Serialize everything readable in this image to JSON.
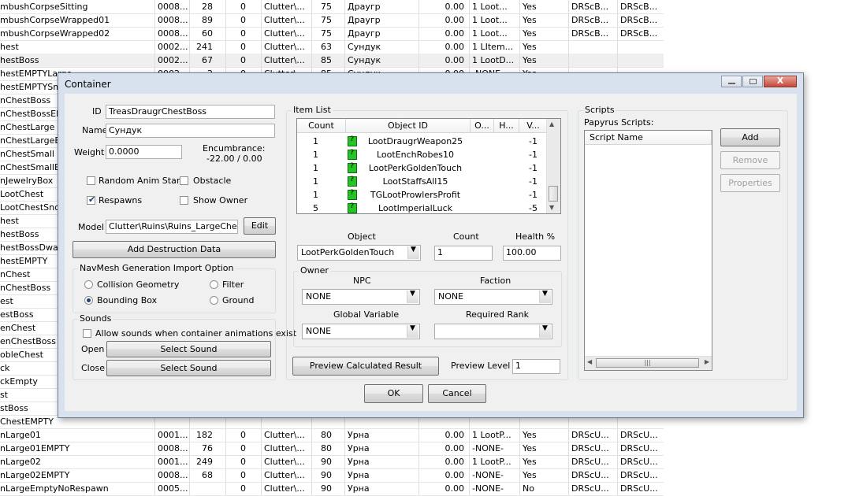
{
  "background_list": {
    "rows": [
      [
        "mbushCorpseSitting",
        "0008...",
        "28",
        "0",
        "Clutter\\...",
        "75",
        "Драугр",
        "0.00",
        "1 Loot...",
        "Yes",
        "DRScB...",
        "DRScB..."
      ],
      [
        "mbushCorpseWrapped01",
        "0008...",
        "89",
        "0",
        "Clutter\\...",
        "75",
        "Драугр",
        "0.00",
        "1 Loot...",
        "Yes",
        "DRScB...",
        "DRScB..."
      ],
      [
        "mbushCorpseWrapped02",
        "0008...",
        "60",
        "0",
        "Clutter\\...",
        "75",
        "Драугр",
        "0.00",
        "1 Loot...",
        "Yes",
        "DRScB...",
        "DRScB..."
      ],
      [
        "hest",
        "0002...",
        "241",
        "0",
        "Clutter\\...",
        "63",
        "Сундук",
        "0.00",
        "1 LItem...",
        "Yes",
        "",
        ""
      ],
      [
        "hestBoss",
        "0002...",
        "67",
        "0",
        "Clutter\\...",
        "85",
        "Сундук",
        "0.00",
        "1 LootD...",
        "Yes",
        "",
        ""
      ],
      [
        "hestEMPTYLarge",
        "0002...",
        "2",
        "0",
        "Clutter\\...",
        "85",
        "Сундук",
        "0.00",
        "-NONE-",
        "Yes",
        "",
        ""
      ],
      [
        "hestEMPTYSm",
        "",
        "",
        "",
        "",
        "",
        "",
        "",
        "",
        "",
        "",
        ""
      ],
      [
        "nChestBoss",
        "",
        "",
        "",
        "",
        "",
        "",
        "",
        "",
        "",
        "",
        ""
      ],
      [
        "nChestBossEMF",
        "",
        "",
        "",
        "",
        "",
        "",
        "",
        "",
        "",
        "",
        ""
      ],
      [
        "nChestLarge",
        "",
        "",
        "",
        "",
        "",
        "",
        "",
        "",
        "",
        "",
        ""
      ],
      [
        "nChestLargeEM",
        "",
        "",
        "",
        "",
        "",
        "",
        "",
        "",
        "",
        "",
        ""
      ],
      [
        "nChestSmall",
        "",
        "",
        "",
        "",
        "",
        "",
        "",
        "",
        "",
        "",
        ""
      ],
      [
        "nChestSmallEM",
        "",
        "",
        "",
        "",
        "",
        "",
        "",
        "",
        "",
        "",
        ""
      ],
      [
        "nJewelryBox",
        "",
        "",
        "",
        "",
        "",
        "",
        "",
        "",
        "",
        "",
        ""
      ],
      [
        "LootChest",
        "",
        "",
        "",
        "",
        "",
        "",
        "",
        "",
        "",
        "",
        ""
      ],
      [
        "LootChestSnow",
        "",
        "",
        "",
        "",
        "",
        "",
        "",
        "",
        "",
        "",
        ""
      ],
      [
        "hest",
        "",
        "",
        "",
        "",
        "",
        "",
        "",
        "",
        "",
        "",
        ""
      ],
      [
        "hestBoss",
        "",
        "",
        "",
        "",
        "",
        "",
        "",
        "",
        "",
        "",
        ""
      ],
      [
        "hestBossDwarv",
        "",
        "",
        "",
        "",
        "",
        "",
        "",
        "",
        "",
        "",
        ""
      ],
      [
        "hestEMPTY",
        "",
        "",
        "",
        "",
        "",
        "",
        "",
        "",
        "",
        "",
        ""
      ],
      [
        "nChest",
        "",
        "",
        "",
        "",
        "",
        "",
        "",
        "",
        "",
        "",
        ""
      ],
      [
        "nChestBoss",
        "",
        "",
        "",
        "",
        "",
        "",
        "",
        "",
        "",
        "",
        ""
      ],
      [
        "est",
        "",
        "",
        "",
        "",
        "",
        "",
        "",
        "",
        "",
        "",
        ""
      ],
      [
        "estBoss",
        "",
        "",
        "",
        "",
        "",
        "",
        "",
        "",
        "",
        "",
        ""
      ],
      [
        "enChest",
        "",
        "",
        "",
        "",
        "",
        "",
        "",
        "",
        "",
        "",
        ""
      ],
      [
        "enChestBoss",
        "",
        "",
        "",
        "",
        "",
        "",
        "",
        "",
        "",
        "",
        ""
      ],
      [
        "obleChest",
        "",
        "",
        "",
        "",
        "",
        "",
        "",
        "",
        "",
        "",
        ""
      ],
      [
        "ck",
        "",
        "",
        "",
        "",
        "",
        "",
        "",
        "",
        "",
        "",
        ""
      ],
      [
        "ckEmpty",
        "",
        "",
        "",
        "",
        "",
        "",
        "",
        "",
        "",
        "",
        ""
      ],
      [
        "st",
        "",
        "",
        "",
        "",
        "",
        "",
        "",
        "",
        "",
        "",
        ""
      ],
      [
        "stBoss",
        "",
        "",
        "",
        "",
        "",
        "",
        "",
        "",
        "",
        "",
        ""
      ],
      [
        "ChestEMPTY",
        "",
        "",
        "",
        "",
        "",
        "",
        "",
        "",
        "",
        "",
        ""
      ],
      [
        "nLarge01",
        "0001...",
        "182",
        "0",
        "Clutter\\...",
        "80",
        "Урна",
        "0.00",
        "1 LootP...",
        "Yes",
        "DRScU...",
        "DRScU..."
      ],
      [
        "nLarge01EMPTY",
        "0008...",
        "76",
        "0",
        "Clutter\\...",
        "80",
        "Урна",
        "0.00",
        "-NONE-",
        "Yes",
        "DRScU...",
        "DRScU..."
      ],
      [
        "nLarge02",
        "0001...",
        "249",
        "0",
        "Clutter\\...",
        "90",
        "Урна",
        "0.00",
        "1 LootP...",
        "Yes",
        "DRScU...",
        "DRScU..."
      ],
      [
        "nLarge02EMPTY",
        "0008...",
        "68",
        "0",
        "Clutter\\...",
        "90",
        "Урна",
        "0.00",
        "-NONE-",
        "Yes",
        "DRScU...",
        "DRScU..."
      ],
      [
        "nLargeEmptyNoRespawn",
        "0005...",
        "",
        "0",
        "Clutter\\...",
        "90",
        "Урна",
        "0.00",
        "-NONE-",
        "No",
        "DRScU...",
        "DRScU..."
      ]
    ]
  },
  "dialog": {
    "title": "Container",
    "close_glyph": "X",
    "left": {
      "id_label": "ID",
      "id_value": "TreasDraugrChestBoss",
      "name_label": "Name",
      "name_value": "Сундук",
      "weight_label": "Weight",
      "weight_value": "0.0000",
      "encumbrance_label": "Encumbrance:",
      "encumbrance_value": "-22.00 / 0.00",
      "random_anim_label": "Random Anim Start",
      "obstacle_label": "Obstacle",
      "respawns_label": "Respawns",
      "show_owner_label": "Show Owner",
      "model_label": "Model",
      "model_value": "Clutter\\Ruins\\Ruins_LargeChest.r",
      "edit_label": "Edit",
      "add_destruction_label": "Add Destruction Data",
      "navmesh_title": "NavMesh Generation Import Option",
      "collision_label": "Collision Geometry",
      "filter_label": "Filter",
      "bounding_label": "Bounding Box",
      "ground_label": "Ground",
      "sounds_title": "Sounds",
      "allow_sounds_label": "Allow sounds when container animations exist",
      "open_label": "Open",
      "close_label": "Close",
      "select_sound_label": "Select Sound"
    },
    "items": {
      "title": "Item List",
      "columns": [
        "Count",
        "Object ID",
        "O...",
        "H...",
        "V..."
      ],
      "rows": [
        {
          "count": "1",
          "object_id": "LootDraugrWeapon25",
          "value": "-1"
        },
        {
          "count": "1",
          "object_id": "LootEnchRobes10",
          "value": "-1"
        },
        {
          "count": "1",
          "object_id": "LootPerkGoldenTouch",
          "value": "-1"
        },
        {
          "count": "1",
          "object_id": "LootStaffsAll15",
          "value": "-1"
        },
        {
          "count": "1",
          "object_id": "TGLootProwlersProfit",
          "value": "-1"
        },
        {
          "count": "5",
          "object_id": "LootImperialLuck",
          "value": "-5"
        }
      ],
      "icon_glyph": "?",
      "object_label": "Object",
      "count_label": "Count",
      "health_label": "Health %",
      "object_value": "LootPerkGoldenTouch",
      "count_value": "1",
      "health_value": "100.00",
      "owner_title": "Owner",
      "npc_label": "NPC",
      "faction_label": "Faction",
      "npc_value": "NONE",
      "faction_value": "NONE",
      "global_var_label": "Global Variable",
      "required_rank_label": "Required Rank",
      "global_var_value": "NONE",
      "required_rank_value": "",
      "preview_button_label": "Preview Calculated Result",
      "preview_level_label": "Preview Level",
      "preview_level_value": "1"
    },
    "scripts": {
      "title": "Scripts",
      "papyrus_label": "Papyrus Scripts:",
      "column": "Script Name",
      "add_label": "Add",
      "remove_label": "Remove",
      "properties_label": "Properties"
    },
    "ok_label": "OK",
    "cancel_label": "Cancel"
  }
}
